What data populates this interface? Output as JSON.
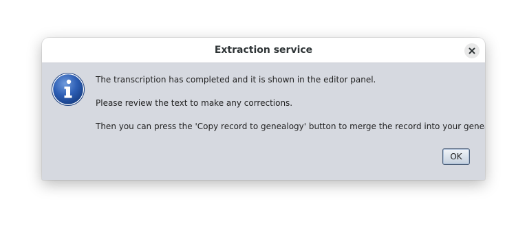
{
  "dialog": {
    "title": "Extraction service",
    "close_icon": "close-icon",
    "icon": "information-icon",
    "messages": [
      "The transcription has completed and it is shown in the editor panel.",
      "Please review the text to make any corrections.",
      "Then you can press the 'Copy record to genealogy' button to merge the record into your genealogy."
    ],
    "ok_label": "OK"
  },
  "colors": {
    "body_background": "#d6d9e0",
    "titlebar_background": "#ffffff",
    "info_icon_blue": "#1f4fa3"
  }
}
